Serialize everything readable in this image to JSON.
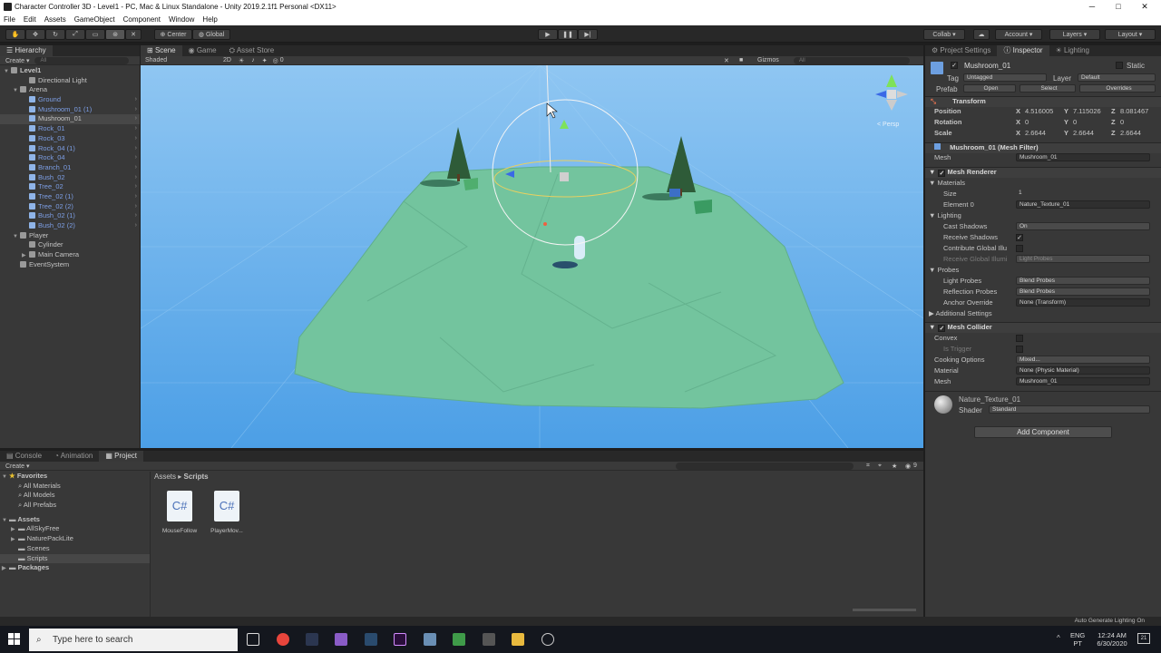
{
  "window": {
    "title": "Character Controller 3D - Level1 - PC, Mac & Linux Standalone - Unity 2019.2.1f1 Personal <DX11>",
    "minimize": "─",
    "maximize": "□",
    "close": "✕"
  },
  "menu": [
    "File",
    "Edit",
    "Assets",
    "GameObject",
    "Component",
    "Window",
    "Help"
  ],
  "toolbar": {
    "pivot": "Center",
    "space": "Global",
    "collab": "Collab ▾",
    "account": "Account",
    "layers": "Layers",
    "layout": "Layout"
  },
  "hierarchy": {
    "tab": "Hierarchy",
    "create": "Create",
    "search_placeholder": "All",
    "items": [
      {
        "label": "Level1",
        "indent": 0,
        "arrow": "▼",
        "icon": "unity",
        "blue": false,
        "sel": false
      },
      {
        "label": "Directional Light",
        "indent": 2,
        "arrow": "",
        "icon": "gray",
        "blue": false,
        "sel": false
      },
      {
        "label": "Arena",
        "indent": 1,
        "arrow": "▼",
        "icon": "gray",
        "blue": false,
        "sel": false
      },
      {
        "label": "Ground",
        "indent": 2,
        "arrow": "",
        "icon": "blue",
        "blue": true,
        "sel": false
      },
      {
        "label": "Mushroom_01 (1)",
        "indent": 2,
        "arrow": "",
        "icon": "blue",
        "blue": true,
        "sel": false
      },
      {
        "label": "Mushroom_01",
        "indent": 2,
        "arrow": "",
        "icon": "blue",
        "blue": false,
        "sel": true
      },
      {
        "label": "Rock_01",
        "indent": 2,
        "arrow": "",
        "icon": "blue",
        "blue": true,
        "sel": false
      },
      {
        "label": "Rock_03",
        "indent": 2,
        "arrow": "",
        "icon": "blue",
        "blue": true,
        "sel": false
      },
      {
        "label": "Rock_04 (1)",
        "indent": 2,
        "arrow": "",
        "icon": "blue",
        "blue": true,
        "sel": false
      },
      {
        "label": "Rock_04",
        "indent": 2,
        "arrow": "",
        "icon": "blue",
        "blue": true,
        "sel": false
      },
      {
        "label": "Branch_01",
        "indent": 2,
        "arrow": "",
        "icon": "blue",
        "blue": true,
        "sel": false
      },
      {
        "label": "Bush_02",
        "indent": 2,
        "arrow": "",
        "icon": "blue",
        "blue": true,
        "sel": false
      },
      {
        "label": "Tree_02",
        "indent": 2,
        "arrow": "",
        "icon": "blue",
        "blue": true,
        "sel": false
      },
      {
        "label": "Tree_02 (1)",
        "indent": 2,
        "arrow": "",
        "icon": "blue",
        "blue": true,
        "sel": false
      },
      {
        "label": "Tree_02 (2)",
        "indent": 2,
        "arrow": "",
        "icon": "blue",
        "blue": true,
        "sel": false
      },
      {
        "label": "Bush_02 (1)",
        "indent": 2,
        "arrow": "",
        "icon": "blue",
        "blue": true,
        "sel": false
      },
      {
        "label": "Bush_02 (2)",
        "indent": 2,
        "arrow": "",
        "icon": "blue",
        "blue": true,
        "sel": false
      },
      {
        "label": "Player",
        "indent": 1,
        "arrow": "▼",
        "icon": "gray",
        "blue": false,
        "sel": false
      },
      {
        "label": "Cylinder",
        "indent": 2,
        "arrow": "",
        "icon": "gray",
        "blue": false,
        "sel": false
      },
      {
        "label": "Main Camera",
        "indent": 2,
        "arrow": "▶",
        "icon": "gray",
        "blue": false,
        "sel": false
      },
      {
        "label": "EventSystem",
        "indent": 1,
        "arrow": "",
        "icon": "gray",
        "blue": false,
        "sel": false
      }
    ]
  },
  "scene": {
    "tabs": [
      "Scene",
      "Game",
      "Asset Store"
    ],
    "shading": "Shaded",
    "mode2d": "2D",
    "fx_count": "0",
    "gizmos": "Gizmos",
    "search_placeholder": "All",
    "persp": "< Persp"
  },
  "project": {
    "tabs": [
      "Console",
      "Animation",
      "Project"
    ],
    "create": "Create",
    "count": "9",
    "favorites_label": "Favorites",
    "favorites": [
      "All Materials",
      "All Models",
      "All Prefabs"
    ],
    "assets_label": "Assets",
    "assets": [
      "AllSkyFree",
      "NaturePackLite",
      "Scenes",
      "Scripts"
    ],
    "packages_label": "Packages",
    "breadcrumb": [
      "Assets",
      "Scripts"
    ],
    "files": [
      {
        "name": "MouseFollow",
        "glyph": "C#"
      },
      {
        "name": "PlayerMov...",
        "glyph": "C#"
      }
    ]
  },
  "inspector": {
    "tabs": [
      "Project Settings",
      "Inspector",
      "Lighting"
    ],
    "object_name": "Mushroom_01",
    "static_label": "Static",
    "tag_label": "Tag",
    "tag_value": "Untagged",
    "layer_label": "Layer",
    "layer_value": "Default",
    "prefab_label": "Prefab",
    "prefab_open": "Open",
    "prefab_select": "Select",
    "prefab_overrides": "Overrides",
    "transform": {
      "title": "Transform",
      "position_label": "Position",
      "rotation_label": "Rotation",
      "scale_label": "Scale",
      "position": {
        "x": "4.516005",
        "y": "7.115026",
        "z": "8.081467"
      },
      "rotation": {
        "x": "0",
        "y": "0",
        "z": "0"
      },
      "scale": {
        "x": "2.6644",
        "y": "2.6644",
        "z": "2.6644"
      }
    },
    "mesh_filter": {
      "title": "Mushroom_01 (Mesh Filter)",
      "mesh_label": "Mesh",
      "mesh_value": "Mushroom_01"
    },
    "mesh_renderer": {
      "title": "Mesh Renderer",
      "materials_label": "Materials",
      "size_label": "Size",
      "size_value": "1",
      "element0_label": "Element 0",
      "element0_value": "Nature_Texture_01",
      "lighting_label": "Lighting",
      "cast_shadows_label": "Cast Shadows",
      "cast_shadows_value": "On",
      "receive_shadows_label": "Receive Shadows",
      "contribute_label": "Contribute Global Illu",
      "receive_gi_label": "Receive Global Illumi",
      "receive_gi_value": "Light Probes",
      "probes_label": "Probes",
      "light_probes_label": "Light Probes",
      "light_probes_value": "Blend Probes",
      "reflection_probes_label": "Reflection Probes",
      "reflection_probes_value": "Blend Probes",
      "anchor_label": "Anchor Override",
      "anchor_value": "None (Transform)",
      "additional_label": "Additional Settings"
    },
    "mesh_collider": {
      "title": "Mesh Collider",
      "convex_label": "Convex",
      "trigger_label": "Is Trigger",
      "cooking_label": "Cooking Options",
      "cooking_value": "Mixed...",
      "material_label": "Material",
      "material_value": "None (Physic Material)",
      "mesh_label": "Mesh",
      "mesh_value": "Mushroom_01"
    },
    "material": {
      "name": "Nature_Texture_01",
      "shader_label": "Shader",
      "shader_value": "Standard"
    },
    "add_component": "Add Component"
  },
  "status": {
    "text": "Auto Generate Lighting On"
  },
  "taskbar": {
    "search_placeholder": "Type here to search",
    "lang": "ENG",
    "region": "PT",
    "time": "12:24 AM",
    "date": "6/30/2020",
    "notif": "21"
  }
}
